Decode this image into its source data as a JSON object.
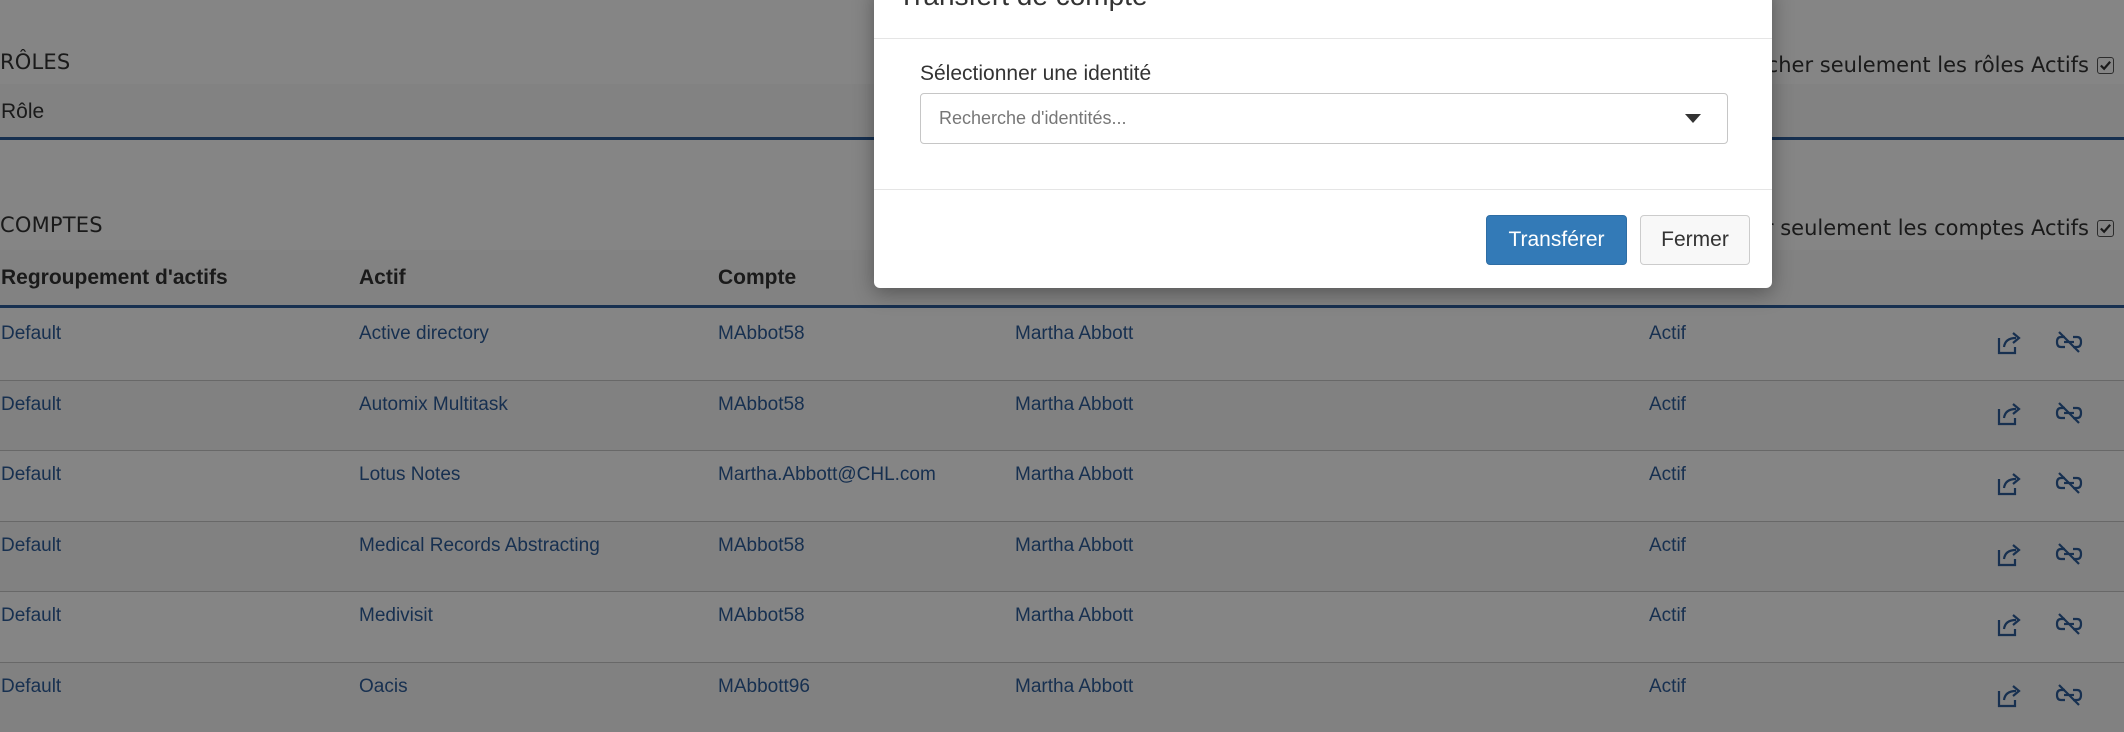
{
  "roles": {
    "title": "RÔLES",
    "toggle_label": "Afficher seulement les rôles Actifs",
    "header": "Rôle"
  },
  "accounts": {
    "title": "COMPTES",
    "toggle_label": "Afficher seulement les comptes Actifs",
    "headers": {
      "group": "Regroupement d'actifs",
      "asset": "Actif",
      "account": "Compte"
    },
    "rows": [
      {
        "group": "Default",
        "asset": "Active directory",
        "account": "MAbbot58",
        "identity": "Martha Abbott",
        "status": "Actif"
      },
      {
        "group": "Default",
        "asset": "Automix Multitask",
        "account": "MAbbot58",
        "identity": "Martha Abbott",
        "status": "Actif"
      },
      {
        "group": "Default",
        "asset": "Lotus Notes",
        "account": "Martha.Abbott@CHL.com",
        "identity": "Martha Abbott",
        "status": "Actif"
      },
      {
        "group": "Default",
        "asset": "Medical Records Abstracting",
        "account": "MAbbot58",
        "identity": "Martha Abbott",
        "status": "Actif"
      },
      {
        "group": "Default",
        "asset": "Medivisit",
        "account": "MAbbot58",
        "identity": "Martha Abbott",
        "status": "Actif"
      },
      {
        "group": "Default",
        "asset": "Oacis",
        "account": "MAbbott96",
        "identity": "Martha Abbott",
        "status": "Actif"
      }
    ],
    "icons": [
      "share-icon",
      "unlink-icon"
    ]
  },
  "modal": {
    "title": "Transfert de compte",
    "field_label": "Sélectionner une identité",
    "select_placeholder": "Recherche d'identités...",
    "primary_button": "Transférer",
    "close_button": "Fermer"
  },
  "colors": {
    "link": "#2d5c99",
    "primary": "#337ab7",
    "header_border": "#2d5c99"
  }
}
